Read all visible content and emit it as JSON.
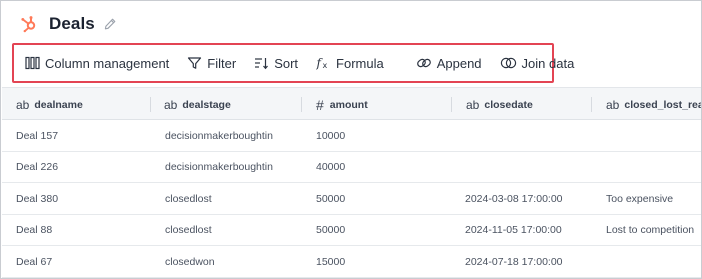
{
  "header": {
    "title": "Deals"
  },
  "toolbar": {
    "column_management": "Column management",
    "filter": "Filter",
    "sort": "Sort",
    "formula": "Formula",
    "append": "Append",
    "join_data": "Join data"
  },
  "table": {
    "columns": [
      {
        "type_glyph": "ab",
        "label": "dealname"
      },
      {
        "type_glyph": "ab",
        "label": "dealstage"
      },
      {
        "type_glyph": "#",
        "label": "amount"
      },
      {
        "type_glyph": "ab",
        "label": "closedate"
      },
      {
        "type_glyph": "ab",
        "label": "closed_lost_reaso"
      }
    ],
    "rows": [
      [
        "Deal 157",
        "decisionmakerboughtin",
        "10000",
        "",
        ""
      ],
      [
        "Deal 226",
        "decisionmakerboughtin",
        "40000",
        "",
        ""
      ],
      [
        "Deal 380",
        "closedlost",
        "50000",
        "2024-03-08 17:00:00",
        "Too expensive"
      ],
      [
        "Deal 88",
        "closedlost",
        "50000",
        "2024-11-05 17:00:00",
        "Lost to competition"
      ],
      [
        "Deal 67",
        "closedwon",
        "15000",
        "2024-07-18 17:00:00",
        ""
      ]
    ]
  },
  "colors": {
    "logo": "#ff7a59",
    "highlight_border": "#e34453",
    "header_bg": "#f4f6f8"
  }
}
